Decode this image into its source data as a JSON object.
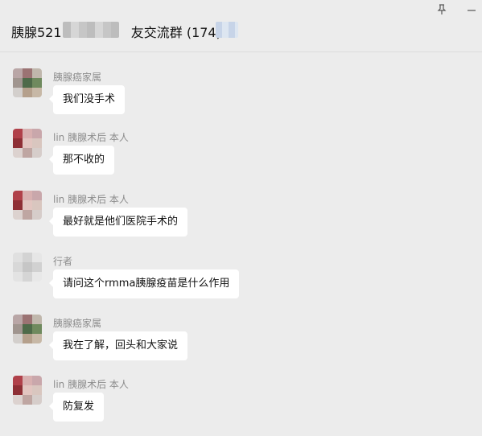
{
  "window": {
    "title": "胰腺521",
    "title_suffix": "友交流群 (174)"
  },
  "messages": [
    {
      "sender": "胰腺癌家属",
      "text": "我们没手术",
      "avatar": "family-avatar-icon"
    },
    {
      "sender": "lin  胰腺术后 本人",
      "text": "那不收的",
      "avatar": "lin-avatar-icon"
    },
    {
      "sender": "lin  胰腺术后 本人",
      "text": "最好就是他们医院手术的",
      "avatar": "lin-avatar-icon"
    },
    {
      "sender": "行者",
      "text": "请问这个rmma胰腺疫苗是什么作用",
      "avatar": "xingzhe-avatar-icon"
    },
    {
      "sender": "胰腺癌家属",
      "text": "我在了解，回头和大家说",
      "avatar": "family-avatar-icon"
    },
    {
      "sender": "lin  胰腺术后 本人",
      "text": "防复发",
      "avatar": "lin-avatar-icon"
    }
  ],
  "colors": {
    "background": "#ececec",
    "bubble": "#ffffff",
    "sender_text": "#8d8d8d",
    "message_text": "#111111"
  }
}
